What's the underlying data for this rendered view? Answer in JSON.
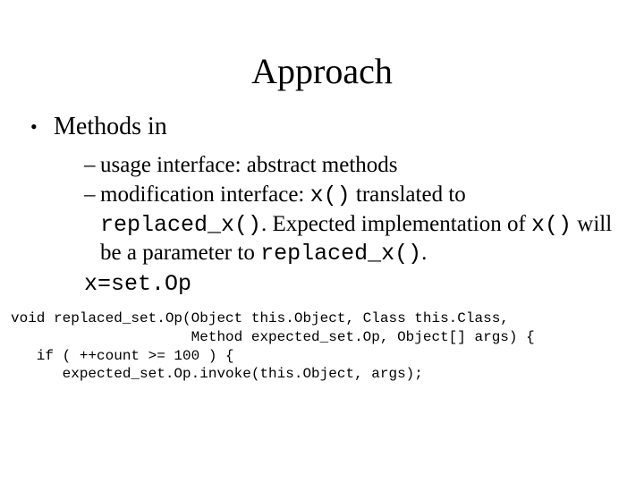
{
  "title": "Approach",
  "lvl1": {
    "bullet": "•",
    "text": "Methods in"
  },
  "lvl2": [
    {
      "dash": "–",
      "plain": "usage interface: abstract methods"
    },
    {
      "dash": "–",
      "seg1": "modification interface: ",
      "code1": "x()",
      "seg2": " translated to ",
      "code2": "replaced_x()",
      "seg3": ". Expected implementation of ",
      "code3": "x()",
      "seg4": " will be a parameter to ",
      "code4": "replaced_x()",
      "seg5": "."
    }
  ],
  "ident": "x=set.Op",
  "code": {
    "l1": "void replaced_set.Op(Object this.Object, Class this.Class,",
    "l2": "                     Method expected_set.Op, Object[] args) {",
    "l3": "   if ( ++count >= 100 ) {",
    "l4": "      expected_set.Op.invoke(this.Object, args);"
  }
}
